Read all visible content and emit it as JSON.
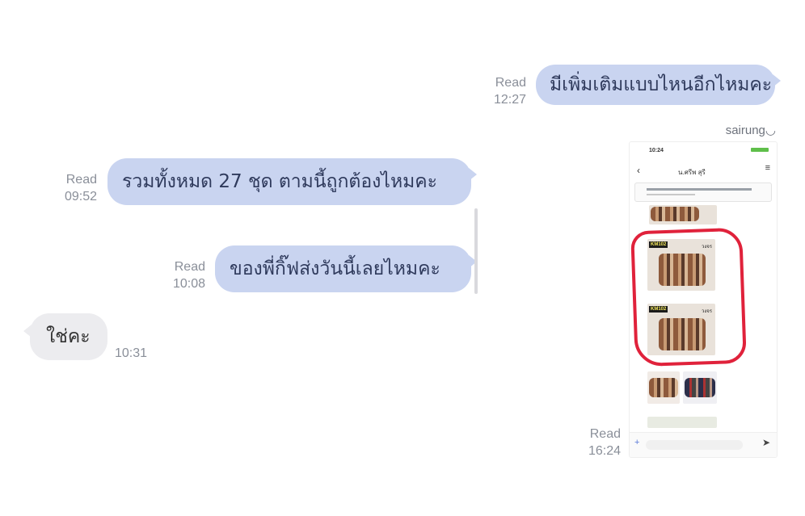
{
  "messages": [
    {
      "id": "m1",
      "text": "มีเพิ่มเติมแบบไหนอีกไหมคะ",
      "status": "Read",
      "time": "12:27"
    },
    {
      "id": "m2",
      "text": "รวมทั้งหมด 27 ชุด ตามนี้ถูกต้องไหมคะ",
      "status": "Read",
      "time": "09:52"
    },
    {
      "id": "m3",
      "text": "ของพี่กิ๊ฟส่งวันนี้เลยไหมคะ",
      "status": "Read",
      "time": "10:08"
    },
    {
      "id": "m4",
      "text": "ใช่คะ",
      "time": "10:31"
    }
  ],
  "image_message": {
    "sender": "sairung◡",
    "status": "Read",
    "time": "16:24",
    "screenshot": {
      "status_time": "10:24",
      "chat_title": "น.ศรีพ สุรี",
      "product_tag_1": "KM102",
      "product_tag_2": "KM102",
      "product_caption": "วงจร"
    }
  },
  "colors": {
    "outgoing_bubble": "#c9d4f0",
    "incoming_bubble": "#ececef",
    "meta_text": "#8a8f99",
    "annotation_red": "#e0223b"
  }
}
